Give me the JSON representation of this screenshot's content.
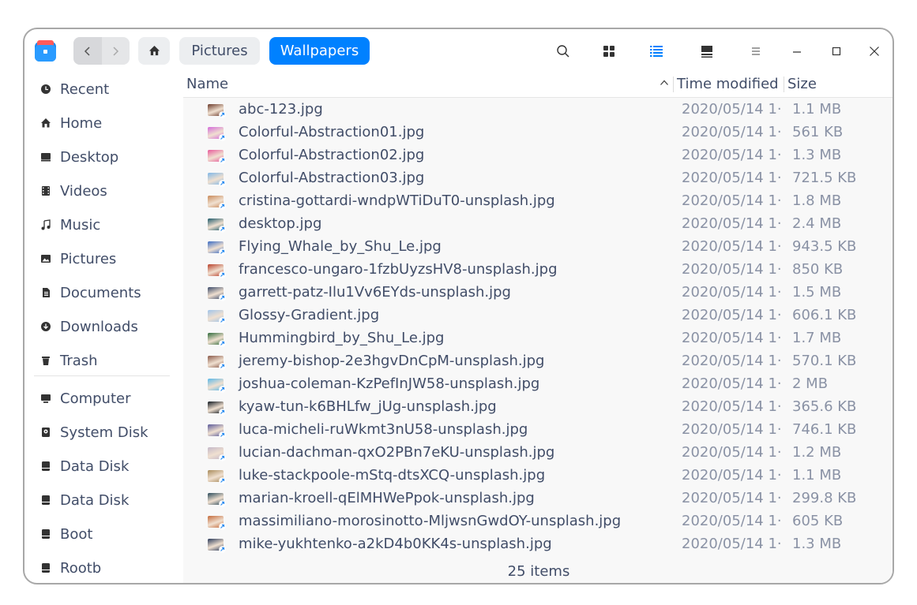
{
  "window": {
    "title": "Wallpapers"
  },
  "toolbar": {
    "breadcrumbs": [
      "Pictures",
      "Wallpapers"
    ],
    "icons": [
      "search-icon",
      "icon-view-icon",
      "list-view-icon",
      "details-view-icon",
      "menu-icon",
      "minimize-icon",
      "maximize-icon",
      "close-icon"
    ]
  },
  "sidebar": {
    "items": [
      {
        "label": "Recent",
        "icon": "clock-icon"
      },
      {
        "label": "Home",
        "icon": "home-icon"
      },
      {
        "label": "Desktop",
        "icon": "desktop-icon"
      },
      {
        "label": "Videos",
        "icon": "video-icon"
      },
      {
        "label": "Music",
        "icon": "music-icon"
      },
      {
        "label": "Pictures",
        "icon": "picture-icon"
      },
      {
        "label": "Documents",
        "icon": "document-icon"
      },
      {
        "label": "Downloads",
        "icon": "download-icon"
      },
      {
        "label": "Trash",
        "icon": "trash-icon"
      },
      {
        "label": "Computer",
        "icon": "computer-icon"
      },
      {
        "label": "System Disk",
        "icon": "system-disk-icon"
      },
      {
        "label": "Data Disk",
        "icon": "disk-icon"
      },
      {
        "label": "Data Disk",
        "icon": "disk-icon"
      },
      {
        "label": "Boot",
        "icon": "disk-icon"
      },
      {
        "label": "Rootb",
        "icon": "disk-icon"
      }
    ]
  },
  "columns": {
    "name": "Name",
    "time": "Time modified",
    "size": "Size"
  },
  "files": [
    {
      "name": "abc-123.jpg",
      "time": "2020/05/14 1···",
      "size": "1.1 MB"
    },
    {
      "name": "Colorful-Abstraction01.jpg",
      "time": "2020/05/14 1···",
      "size": "561 KB"
    },
    {
      "name": "Colorful-Abstraction02.jpg",
      "time": "2020/05/14 1···",
      "size": "1.3 MB"
    },
    {
      "name": "Colorful-Abstraction03.jpg",
      "time": "2020/05/14 1···",
      "size": "721.5 KB"
    },
    {
      "name": "cristina-gottardi-wndpWTiDuT0-unsplash.jpg",
      "time": "2020/05/14 1···",
      "size": "1.8 MB"
    },
    {
      "name": "desktop.jpg",
      "time": "2020/05/14 1···",
      "size": "2.4 MB"
    },
    {
      "name": "Flying_Whale_by_Shu_Le.jpg",
      "time": "2020/05/14 1···",
      "size": "943.5 KB"
    },
    {
      "name": "francesco-ungaro-1fzbUyzsHV8-unsplash.jpg",
      "time": "2020/05/14 1···",
      "size": "850 KB"
    },
    {
      "name": "garrett-patz-Ilu1Vv6EYds-unsplash.jpg",
      "time": "2020/05/14 1···",
      "size": "1.5 MB"
    },
    {
      "name": "Glossy-Gradient.jpg",
      "time": "2020/05/14 1···",
      "size": "606.1 KB"
    },
    {
      "name": "Hummingbird_by_Shu_Le.jpg",
      "time": "2020/05/14 1···",
      "size": "1.7 MB"
    },
    {
      "name": "jeremy-bishop-2e3hgvDnCpM-unsplash.jpg",
      "time": "2020/05/14 1···",
      "size": "570.1 KB"
    },
    {
      "name": "joshua-coleman-KzPefInJW58-unsplash.jpg",
      "time": "2020/05/14 1···",
      "size": "2 MB"
    },
    {
      "name": "kyaw-tun-k6BHLfw_jUg-unsplash.jpg",
      "time": "2020/05/14 1···",
      "size": "365.6 KB"
    },
    {
      "name": "luca-micheli-ruWkmt3nU58-unsplash.jpg",
      "time": "2020/05/14 1···",
      "size": "746.1 KB"
    },
    {
      "name": "lucian-dachman-qxO2PBn7eKU-unsplash.jpg",
      "time": "2020/05/14 1···",
      "size": "1.2 MB"
    },
    {
      "name": "luke-stackpoole-mStq-dtsXCQ-unsplash.jpg",
      "time": "2020/05/14 1···",
      "size": "1.1 MB"
    },
    {
      "name": "marian-kroell-qElMHWePpok-unsplash.jpg",
      "time": "2020/05/14 1···",
      "size": "299.8 KB"
    },
    {
      "name": "massimiliano-morosinotto-MljwsnGwdOY-unsplash.jpg",
      "time": "2020/05/14 1···",
      "size": "605 KB"
    },
    {
      "name": "mike-yukhtenko-a2kD4b0KK4s-unsplash.jpg",
      "time": "2020/05/14 1···",
      "size": "1.3 MB"
    }
  ],
  "thumb_colors": [
    "#6b3a2a",
    "#d46bd9",
    "#e85a9a",
    "#7fb7e8",
    "#c98a5a",
    "#1f5a6a",
    "#3a6bc4",
    "#b8402a",
    "#3a4a6a",
    "#9fc4ea",
    "#2f6a3a",
    "#8a5a4a",
    "#5ab8e8",
    "#101820",
    "#5a5a9a",
    "#c4b8c8",
    "#a88a5a",
    "#2a4a5a",
    "#c46a3a",
    "#2a3a5a"
  ],
  "status": {
    "items": "25 items"
  },
  "colors": {
    "accent": "#0081ff",
    "text": "#414d68",
    "muted": "#8a92a5"
  }
}
